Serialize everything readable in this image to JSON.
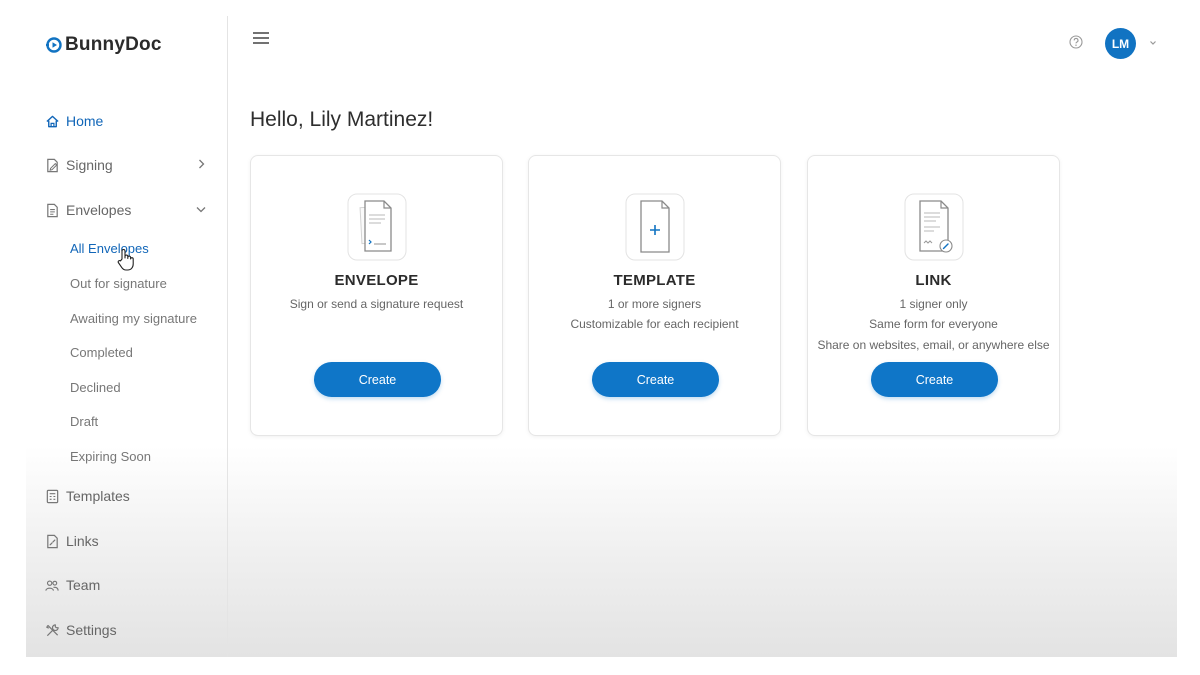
{
  "app": {
    "name": "BunnyDoc",
    "brand_color": "#1173c2"
  },
  "sidebar": {
    "items": [
      {
        "label": "Home",
        "icon": "home-icon",
        "active": true
      },
      {
        "label": "Signing",
        "icon": "signing-icon",
        "chevron": "right"
      },
      {
        "label": "Envelopes",
        "icon": "envelopes-icon",
        "chevron": "down"
      },
      {
        "label": "Templates",
        "icon": "templates-icon"
      },
      {
        "label": "Links",
        "icon": "links-icon"
      },
      {
        "label": "Team",
        "icon": "team-icon"
      },
      {
        "label": "Settings",
        "icon": "settings-icon"
      }
    ],
    "envelope_subitems": [
      {
        "label": "All Envelopes",
        "active": true
      },
      {
        "label": "Out for signature"
      },
      {
        "label": "Awaiting my signature"
      },
      {
        "label": "Completed"
      },
      {
        "label": "Declined"
      },
      {
        "label": "Draft"
      },
      {
        "label": "Expiring Soon"
      }
    ]
  },
  "header": {
    "avatar_initials": "LM"
  },
  "main": {
    "greeting": "Hello, Lily Martinez!",
    "cards": [
      {
        "title": "ENVELOPE",
        "lines": [
          "Sign or send a signature request"
        ],
        "button": "Create",
        "icon": "envelope-document-icon"
      },
      {
        "title": "TEMPLATE",
        "lines": [
          "1 or more signers",
          "Customizable for each recipient"
        ],
        "button": "Create",
        "icon": "template-document-icon"
      },
      {
        "title": "LINK",
        "lines": [
          "1 signer only",
          "Same form for everyone",
          "Share on websites, email, or anywhere else"
        ],
        "button": "Create",
        "icon": "link-document-icon"
      }
    ]
  }
}
